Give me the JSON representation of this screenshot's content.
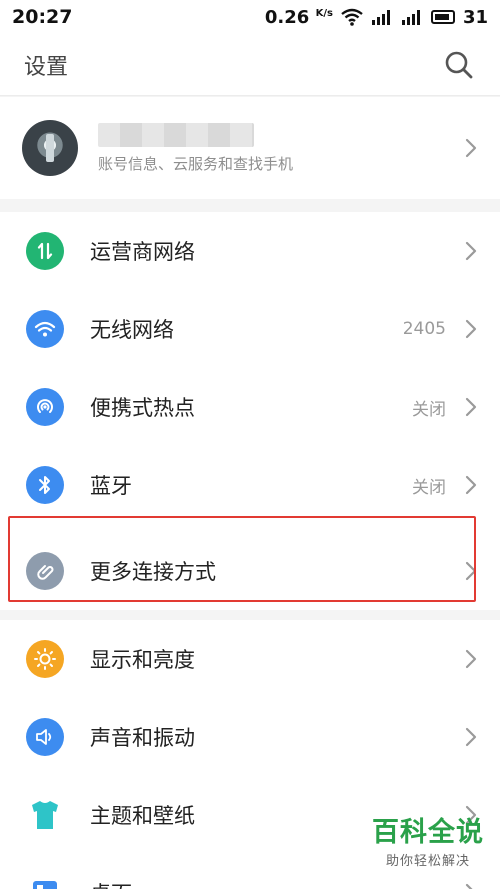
{
  "status_bar": {
    "time": "20:27",
    "speed": "0.26",
    "speed_unit": "K/s",
    "battery": "31"
  },
  "header": {
    "title": "设置"
  },
  "account": {
    "subtitle": "账号信息、云服务和查找手机"
  },
  "group_connections": [
    {
      "label": "运营商网络",
      "value": "",
      "icon": "carrier-network-icon",
      "color": "#22b573"
    },
    {
      "label": "无线网络",
      "value": "2405",
      "icon": "wifi-icon",
      "color": "#3d8cf0"
    },
    {
      "label": "便携式热点",
      "value": "关闭",
      "icon": "hotspot-icon",
      "color": "#3d8cf0"
    },
    {
      "label": "蓝牙",
      "value": "关闭",
      "icon": "bluetooth-icon",
      "color": "#3d8cf0"
    },
    {
      "label": "更多连接方式",
      "value": "",
      "icon": "link-icon",
      "color": "#8e9cad"
    }
  ],
  "group_display": [
    {
      "label": "显示和亮度",
      "icon": "brightness-icon",
      "color": "#f5a623"
    },
    {
      "label": "声音和振动",
      "icon": "sound-icon",
      "color": "#3d8cf0"
    },
    {
      "label": "主题和壁纸",
      "icon": "theme-icon",
      "color": "#2ec4c8"
    },
    {
      "label": "桌面",
      "icon": "desktop-icon",
      "color": "#3d8cf0"
    }
  ],
  "watermark": {
    "title": "百科全说",
    "subtitle": "助你轻松解决"
  },
  "colors": {
    "highlight": "#e23a33",
    "chevron": "#9a9a9a",
    "watermark": "#2aa14a"
  }
}
